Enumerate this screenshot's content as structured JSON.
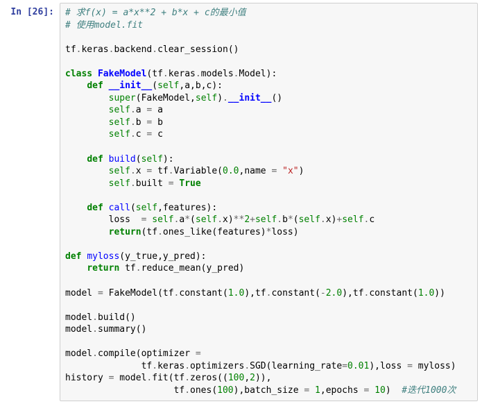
{
  "prompt": {
    "label": "In [26]:"
  },
  "code": {
    "c_line1": "# 求f(x) = a*x**2 + b*x + c的最小值",
    "c_line2": "# 使用model.fit",
    "l01a": "tf",
    "l01b": ".",
    "l01c": "keras",
    "l01d": ".",
    "l01e": "backend",
    "l01f": ".",
    "l01g": "clear_session",
    "l01h": "()",
    "kw_class": "class",
    "cls_name": "FakeModel",
    "cls_base_open": "(",
    "cls_base": "tf",
    "cls_dot1": ".",
    "cls_keras": "keras",
    "cls_dot2": ".",
    "cls_models": "models",
    "cls_dot3": ".",
    "cls_Model": "Model",
    "cls_close": "):",
    "kw_def": "def",
    "fn_init": "__init__",
    "init_args_open": "(",
    "init_self": "self",
    "init_comma": ",a,b,c):",
    "super_kw": "super",
    "super_open": "(",
    "super_Fake": "FakeModel",
    "super_comma": ",",
    "super_self": "self",
    "super_close": ")",
    "super_dot": ".",
    "super_init": "__init__",
    "super_call": "()",
    "sa_self": "self",
    "sa_dot": ".",
    "sa_a": "a ",
    "sa_eq": "=",
    "sa_rhs": " a",
    "sb_self": "self",
    "sb_dot": ".",
    "sb_b": "b ",
    "sb_eq": "=",
    "sb_rhs": " b",
    "sc_self": "self",
    "sc_dot": ".",
    "sc_c": "c ",
    "sc_eq": "=",
    "sc_rhs": " c",
    "fn_build": "build",
    "build_args": "(",
    "build_self": "self",
    "build_close": "):",
    "bx_self": "self",
    "bx_dot": ".",
    "bx_x": "x ",
    "bx_eq": "=",
    "bx_tf": " tf",
    "bx_d": ".",
    "bx_Var": "Variable(",
    "bx_zero": "0.0",
    "bx_c": ",name ",
    "bx_eq2": "=",
    "bx_sp": " ",
    "bx_str": "\"x\"",
    "bx_end": ")",
    "bb_self": "self",
    "bb_dot": ".",
    "bb_built": "built ",
    "bb_eq": "=",
    "bb_sp": " ",
    "bb_true": "True",
    "fn_call": "call",
    "call_open": "(",
    "call_self": "self",
    "call_args": ",features):",
    "loss_lhs": "loss  ",
    "loss_eq": "=",
    "loss_sp": " ",
    "loss_self1": "self",
    "loss_d1": ".",
    "loss_a": "a",
    "loss_star": "*",
    "loss_po": "(",
    "loss_self2": "self",
    "loss_d2": ".",
    "loss_x1": "x)",
    "loss_pow": "**",
    "loss_two": "2",
    "loss_plus": "+",
    "loss_self3": "self",
    "loss_d3": ".",
    "loss_b": "b",
    "loss_star2": "*",
    "loss_po2": "(",
    "loss_self4": "self",
    "loss_d4": ".",
    "loss_x2": "x)",
    "loss_plus2": "+",
    "loss_self5": "self",
    "loss_d5": ".",
    "loss_c": "c",
    "kw_return": "return",
    "ret_open": "(tf",
    "ret_d": ".",
    "ret_ones": "ones_like(features)",
    "ret_star": "*",
    "ret_loss": "loss)",
    "fn_myloss": "myloss",
    "ml_open": "(y_true,y_pred):",
    "ml_ret_kw": "return",
    "ml_sp": " tf",
    "ml_d": ".",
    "ml_rm": "reduce_mean(y_pred)",
    "m_model": "model ",
    "m_eq": "=",
    "m_sp": " FakeModel(tf",
    "m_d1": ".",
    "m_const1": "constant(",
    "m_v1": "1.0",
    "m_c1": "),tf",
    "m_d2": ".",
    "m_const2": "constant(",
    "m_neg": "-",
    "m_v2": "2.0",
    "m_c2": "),tf",
    "m_d3": ".",
    "m_const3": "constant(",
    "m_v3": "1.0",
    "m_c3": "))",
    "mb": "model",
    "mb_d": ".",
    "mb_build": "build()",
    "ms": "model",
    "ms_d": ".",
    "ms_sum": "summary()",
    "mc": "model",
    "mc_d": ".",
    "mc_comp": "compile(optimizer ",
    "mc_eq": "=",
    "mc2_pre": "              tf",
    "mc2_d": ".",
    "mc2_k": "keras",
    "mc2_d2": ".",
    "mc2_opt": "optimizers",
    "mc2_d3": ".",
    "mc2_sgd": "SGD(learning_rate",
    "mc2_eq": "=",
    "mc2_lr": "0.01",
    "mc2_c": "),loss ",
    "mc2_eq2": "=",
    "mc2_ml": " myloss)",
    "h_hist": "history ",
    "h_eq": "=",
    "h_sp": " model",
    "h_d": ".",
    "h_fit": "fit(tf",
    "h_d2": ".",
    "h_z": "zeros((",
    "h_100": "100",
    "h_c": ",",
    "h_2": "2",
    "h_close": ")),",
    "h2_pre": "                    tf",
    "h2_d": ".",
    "h2_ones": "ones(",
    "h2_100": "100",
    "h2_c": "),batch_size ",
    "h2_eq": "=",
    "h2_sp": " ",
    "h2_1": "1",
    "h2_c2": ",epochs ",
    "h2_eq2": "=",
    "h2_sp2": " ",
    "h2_10": "10",
    "h2_close": ")  ",
    "h2_cmt": "#迭代1000次"
  }
}
